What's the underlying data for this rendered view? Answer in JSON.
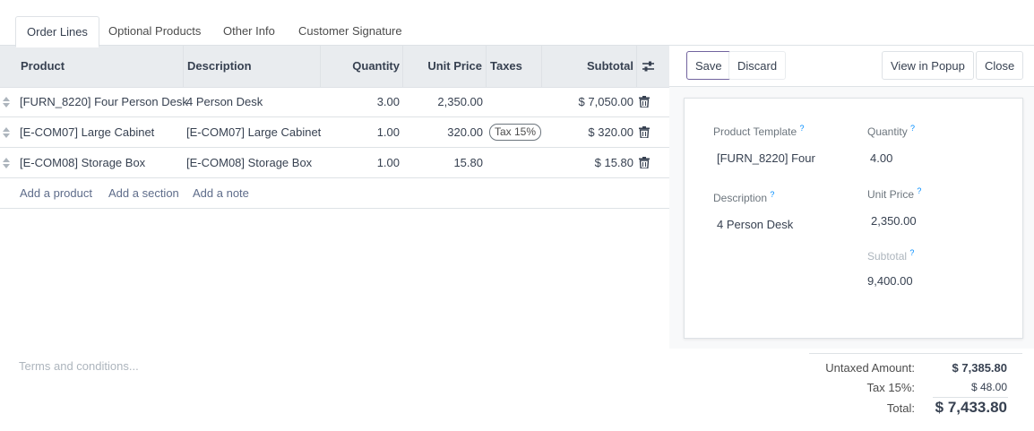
{
  "tabs": [
    {
      "label": "Order Lines",
      "active": true
    },
    {
      "label": "Optional Products"
    },
    {
      "label": "Other Info"
    },
    {
      "label": "Customer Signature"
    }
  ],
  "table": {
    "headers": {
      "product": "Product",
      "description": "Description",
      "quantity": "Quantity",
      "unit_price": "Unit Price",
      "taxes": "Taxes",
      "subtotal": "Subtotal"
    },
    "rows": [
      {
        "product": "[FURN_8220] Four Person Desk",
        "description": "4 Person Desk",
        "quantity": "3.00",
        "unit_price": "2,350.00",
        "taxes": "",
        "subtotal": "$ 7,050.00"
      },
      {
        "product": "[E-COM07] Large Cabinet",
        "description": "[E-COM07] Large Cabinet",
        "quantity": "1.00",
        "unit_price": "320.00",
        "taxes": "Tax 15%",
        "subtotal": "$ 320.00"
      },
      {
        "product": "[E-COM08] Storage Box",
        "description": "[E-COM08] Storage Box",
        "quantity": "1.00",
        "unit_price": "15.80",
        "taxes": "",
        "subtotal": "$ 15.80"
      }
    ],
    "add_product": "Add a product",
    "add_section": "Add a section",
    "add_note": "Add a note"
  },
  "panel": {
    "save": "Save",
    "discard": "Discard",
    "view_popup": "View in Popup",
    "close": "Close",
    "product_template_label": "Product Template",
    "product_template_value": "[FURN_8220] Four",
    "quantity_label": "Quantity",
    "quantity_value": "4.00",
    "description_label": "Description",
    "description_value": "4 Person Desk",
    "unit_price_label": "Unit Price",
    "unit_price_value": "2,350.00",
    "subtotal_label": "Subtotal",
    "subtotal_value": "9,400.00",
    "help_mark": "?"
  },
  "footer": {
    "terms_placeholder": "Terms and conditions...",
    "untaxed_label": "Untaxed Amount:",
    "untaxed_value": "$ 7,385.80",
    "tax_label": "Tax 15%:",
    "tax_value": "$ 48.00",
    "total_label": "Total:",
    "total_value": "$ 7,433.80"
  },
  "colors": {
    "accent": "#71639e",
    "header_bg": "#e9ecef",
    "help": "#008cff"
  },
  "icons": [
    "drag-handle-icon",
    "trash-icon",
    "column-settings-icon"
  ]
}
